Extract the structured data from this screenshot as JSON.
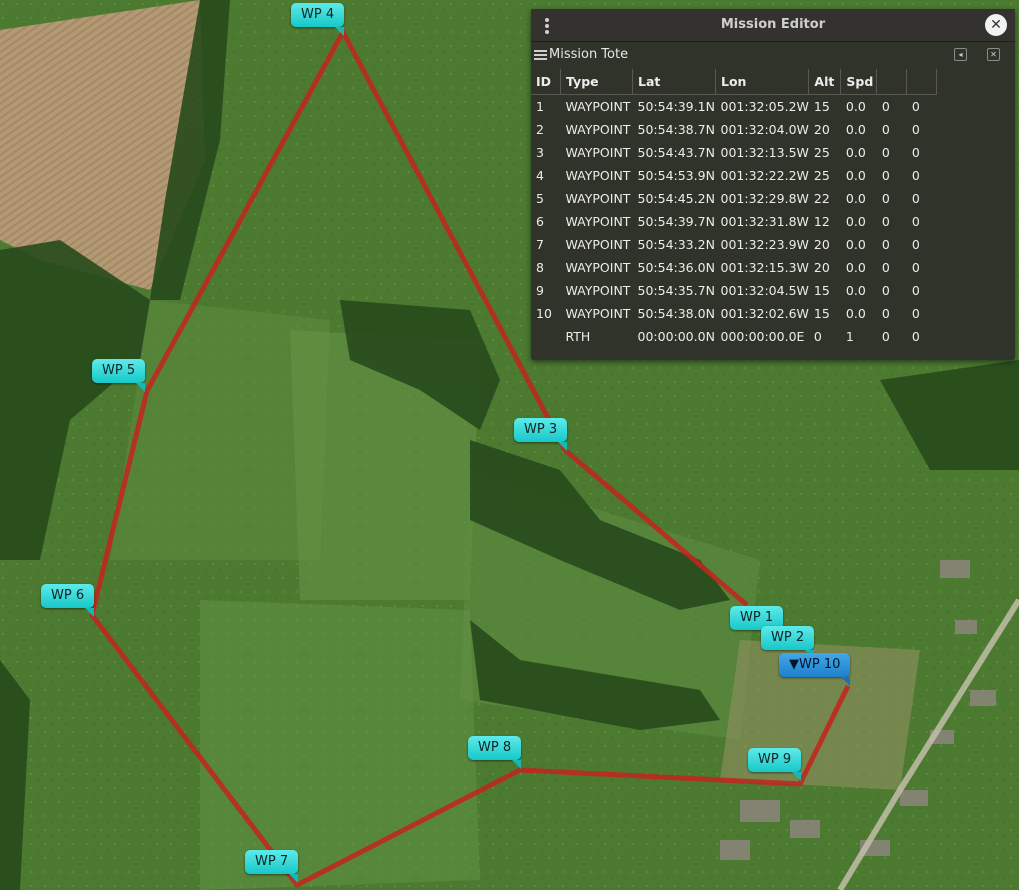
{
  "map": {
    "waypoint_markers": [
      {
        "label": "WP 4",
        "selected": false
      },
      {
        "label": "WP 5",
        "selected": false
      },
      {
        "label": "WP 3",
        "selected": false
      },
      {
        "label": "WP 6",
        "selected": false
      },
      {
        "label": "WP 1",
        "selected": false
      },
      {
        "label": "WP 2",
        "selected": false
      },
      {
        "label": "▼WP 10",
        "selected": true
      },
      {
        "label": "WP 8",
        "selected": false
      },
      {
        "label": "WP 9",
        "selected": false
      },
      {
        "label": "WP 7",
        "selected": false
      }
    ],
    "route_color": "#c4231d",
    "marker_color": "#16c8c8",
    "selected_marker_color": "#2a8fd8"
  },
  "mission_editor": {
    "title": "Mission Editor",
    "close_icon": "close-icon",
    "menu_icon": "vertical-dots-icon",
    "tote": {
      "title": "Mission Tote",
      "menu_icon": "hamburger-icon",
      "undock_icon": "undock-icon",
      "close_icon": "close-icon"
    },
    "columns": [
      "ID",
      "Type",
      "Lat",
      "Lon",
      "Alt",
      "Spd",
      "",
      ""
    ],
    "rows": [
      [
        "1",
        "WAYPOINT",
        "50:54:39.1N",
        "001:32:05.2W",
        "15",
        "0.0",
        "0",
        "0"
      ],
      [
        "2",
        "WAYPOINT",
        "50:54:38.7N",
        "001:32:04.0W",
        "20",
        "0.0",
        "0",
        "0"
      ],
      [
        "3",
        "WAYPOINT",
        "50:54:43.7N",
        "001:32:13.5W",
        "25",
        "0.0",
        "0",
        "0"
      ],
      [
        "4",
        "WAYPOINT",
        "50:54:53.9N",
        "001:32:22.2W",
        "25",
        "0.0",
        "0",
        "0"
      ],
      [
        "5",
        "WAYPOINT",
        "50:54:45.2N",
        "001:32:29.8W",
        "22",
        "0.0",
        "0",
        "0"
      ],
      [
        "6",
        "WAYPOINT",
        "50:54:39.7N",
        "001:32:31.8W",
        "12",
        "0.0",
        "0",
        "0"
      ],
      [
        "7",
        "WAYPOINT",
        "50:54:33.2N",
        "001:32:23.9W",
        "20",
        "0.0",
        "0",
        "0"
      ],
      [
        "8",
        "WAYPOINT",
        "50:54:36.0N",
        "001:32:15.3W",
        "20",
        "0.0",
        "0",
        "0"
      ],
      [
        "9",
        "WAYPOINT",
        "50:54:35.7N",
        "001:32:04.5W",
        "15",
        "0.0",
        "0",
        "0"
      ],
      [
        "10",
        "WAYPOINT",
        "50:54:38.0N",
        "001:32:02.6W",
        "15",
        "0.0",
        "0",
        "0"
      ],
      [
        "",
        "RTH",
        "00:00:00.0N",
        "000:00:00.0E",
        "0",
        "1",
        "0",
        "0"
      ]
    ]
  }
}
